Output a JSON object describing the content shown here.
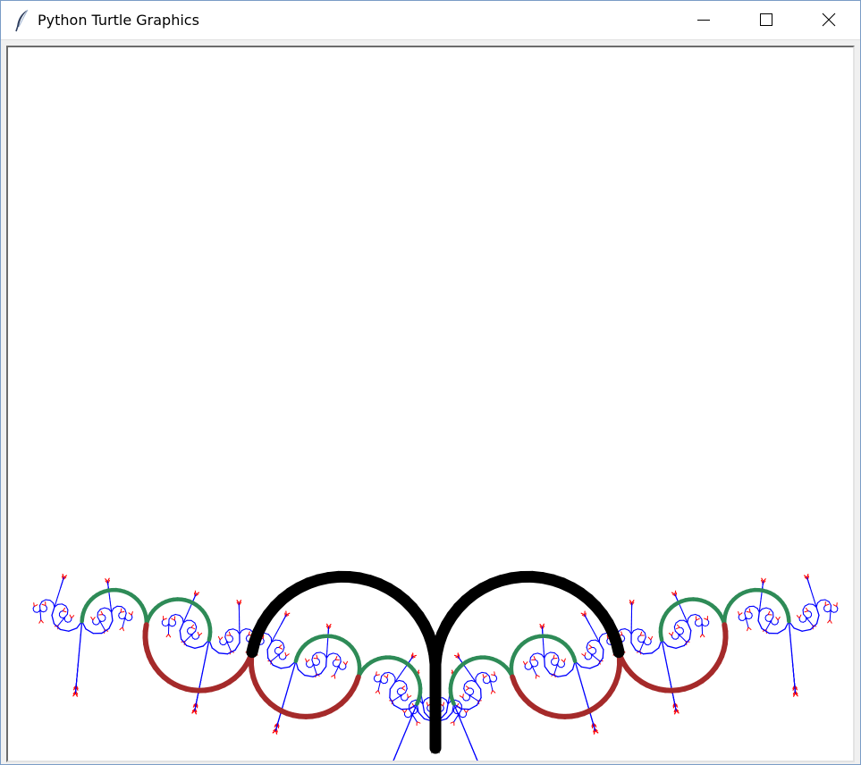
{
  "window": {
    "title": "Python Turtle Graphics",
    "icon": "feather-icon",
    "controls": [
      "minimize-icon",
      "maximize-icon",
      "close-icon"
    ]
  },
  "canvas": {
    "background": "#ffffff",
    "drawing": "fractal-tree",
    "colors": {
      "trunk": "#000000",
      "level_1": "#a52a2a",
      "level_2": "#2e8b57",
      "twigs": "#0000ff",
      "tips": "#ff0000"
    }
  }
}
